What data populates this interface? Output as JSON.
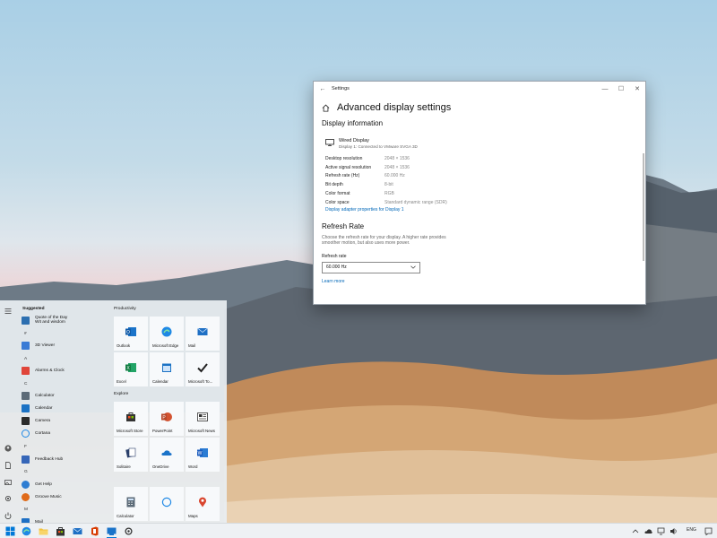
{
  "window": {
    "app_title": "Settings",
    "back": "←",
    "minimize": "—",
    "maximize": "☐",
    "close": "✕",
    "page_title": "Advanced display settings",
    "section_display_info": "Display information",
    "display_name": "Wired Display",
    "display_subtitle": "Display 1: Connected to VMware SVGA 3D",
    "info_rows": [
      {
        "key": "Desktop resolution",
        "value": "2048 × 1536"
      },
      {
        "key": "Active signal resolution",
        "value": "2048 × 1536"
      },
      {
        "key": "Refresh rate (Hz)",
        "value": "60.000 Hz"
      },
      {
        "key": "Bit depth",
        "value": "8-bit"
      },
      {
        "key": "Color format",
        "value": "RGB"
      },
      {
        "key": "Color space",
        "value": "Standard dynamic range (SDR)"
      }
    ],
    "adapter_link": "Display adapter properties for Display 1",
    "section_refresh": "Refresh Rate",
    "refresh_desc": "Choose the refresh rate for your display. A higher rate provides smoother motion, but also uses more power.",
    "refresh_label": "Refresh rate",
    "refresh_value": "60.000 Hz",
    "learn_more": "Learn more"
  },
  "start_menu": {
    "suggested": "Suggested",
    "quote_line1": "Quote of the Day",
    "quote_line2": "Wit and wisdom",
    "apps": [
      {
        "letter": "#"
      },
      {
        "name": "3D Viewer"
      },
      {
        "letter": "A"
      },
      {
        "name": "Alarms & Clock"
      },
      {
        "letter": "C"
      },
      {
        "name": "Calculator"
      },
      {
        "name": "Calendar"
      },
      {
        "name": "Camera"
      },
      {
        "name": "Cortana"
      },
      {
        "letter": "F"
      },
      {
        "name": "Feedback Hub"
      },
      {
        "letter": "G"
      },
      {
        "name": "Get Help"
      },
      {
        "name": "Groove Music"
      },
      {
        "letter": "M"
      },
      {
        "name": "Mail"
      }
    ],
    "group_productivity": "Productivity",
    "group_explore": "Explore",
    "tiles_productivity": [
      "Outlook",
      "Microsoft Edge",
      "Mail",
      "Excel",
      "Calendar",
      "Microsoft To..."
    ],
    "tiles_explore": [
      "Microsoft Store",
      "PowerPoint",
      "Microsoft News",
      "Solitaire",
      "OneDrive",
      "Word"
    ],
    "tiles_bottom": [
      "Calculator",
      "",
      "Maps"
    ]
  },
  "taskbar": {
    "language": "ENG",
    "colors": {
      "start_blue": "#0078d7",
      "edge": "#1e88e5",
      "explorer": "#f3c23c"
    }
  }
}
